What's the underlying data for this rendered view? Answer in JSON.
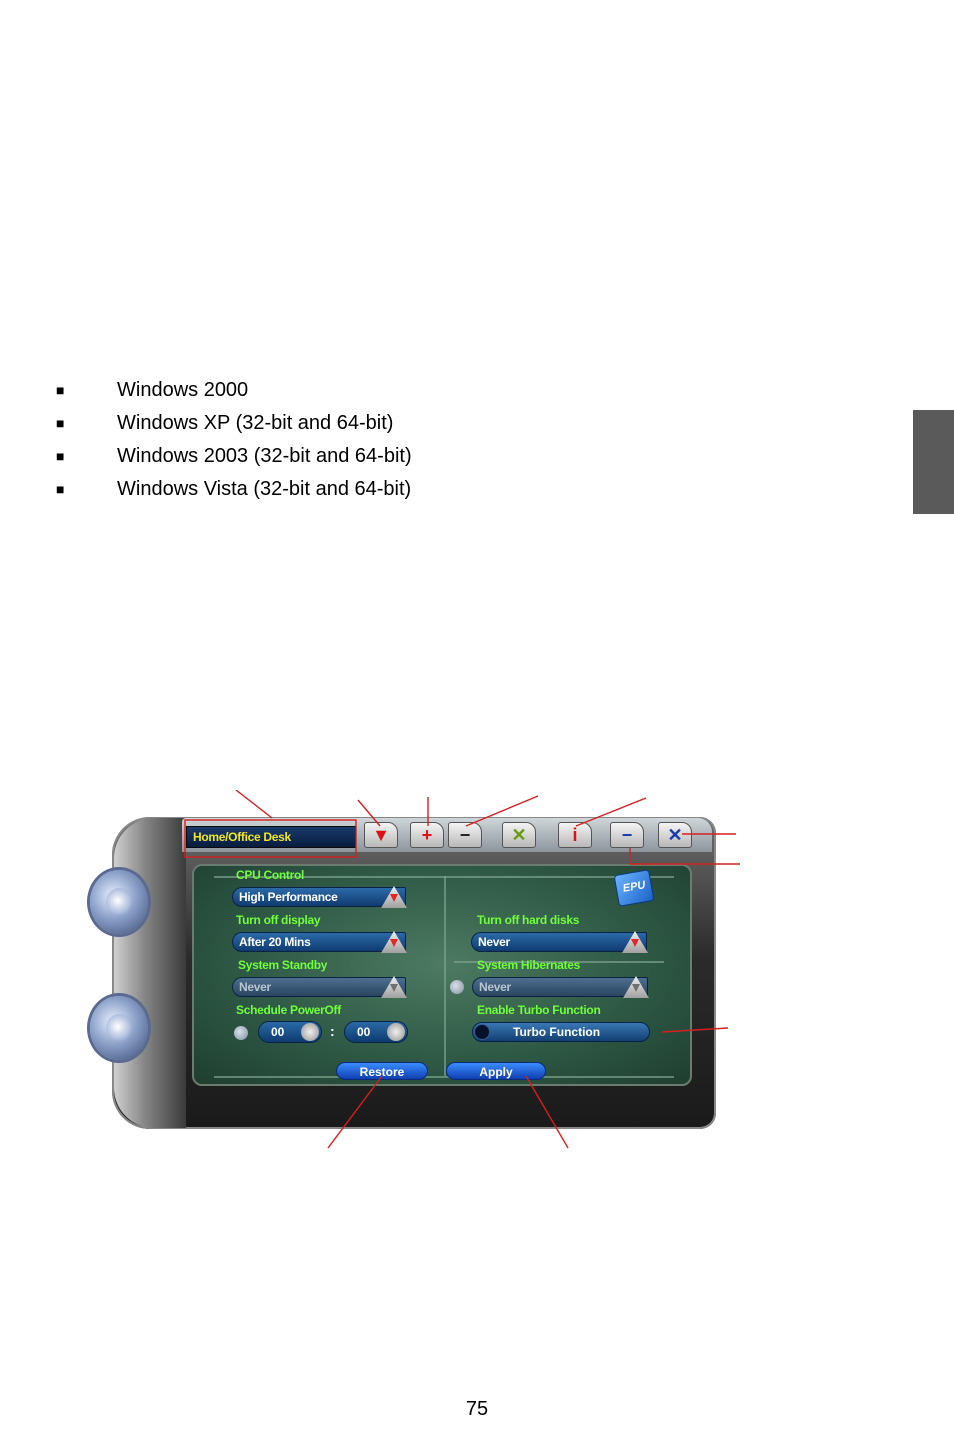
{
  "supported_os": {
    "bullet": "■",
    "items": [
      "Windows 2000",
      "Windows XP (32-bit and 64-bit)",
      "Windows 2003 (32-bit and 64-bit)",
      "Windows Vista (32-bit and 64-bit)"
    ]
  },
  "utility": {
    "profile": "Home/Office Desk",
    "logo": "EPU",
    "cpu_control": {
      "label": "CPU Control",
      "value": "High Performance"
    },
    "turn_off_display": {
      "label": "Turn off display",
      "value": "After 20 Mins"
    },
    "turn_off_hard_disks": {
      "label": "Turn off hard disks",
      "value": "Never"
    },
    "system_standby": {
      "label": "System Standby",
      "value": "Never"
    },
    "system_hibernates": {
      "label": "System Hibernates",
      "value": "Never"
    },
    "schedule_poweroff": {
      "label": "Schedule PowerOff",
      "hour": "00",
      "separator": ":",
      "minute": "00"
    },
    "turbo": {
      "label": "Enable Turbo Function",
      "button": "Turbo Function"
    },
    "restore": "Restore",
    "apply": "Apply"
  },
  "colors": {
    "callout": "#d42020",
    "green_label": "#70ff3a",
    "profile_text": "#f0e62a"
  },
  "page_number": "75"
}
